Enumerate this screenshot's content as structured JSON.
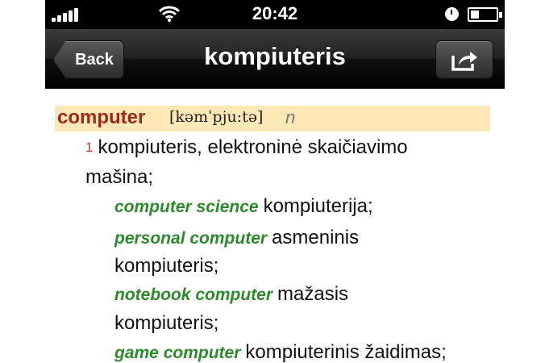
{
  "status_bar": {
    "time": "20:42",
    "icons": [
      "signal-bars-icon",
      "wifi-icon",
      "clock-icon",
      "battery-icon"
    ]
  },
  "nav": {
    "back_label": "Back",
    "title": "kompiuteris",
    "share_icon": "share-icon"
  },
  "entry": {
    "headword": "computer",
    "pronunciation": "[kəmˈpju:tə]",
    "part_of_speech": "n",
    "sense_number": "1",
    "definition_line1": "kompiuteris, elektroninė skaičiavimo",
    "definition_line2": "mašina;",
    "examples": [
      {
        "phrase": "computer science",
        "translation": "kompiuterija;",
        "continuation": ""
      },
      {
        "phrase": "personal computer",
        "translation": "asmeninis",
        "continuation": "kompiuteris;"
      },
      {
        "phrase": "notebook computer",
        "translation": "mažasis",
        "continuation": "kompiuteris;"
      },
      {
        "phrase": "game computer",
        "translation": "kompiuterinis žaidimas;",
        "continuation": ""
      }
    ]
  },
  "colors": {
    "headword": "#9b2a1c",
    "example": "#2c8a2c",
    "highlight": "#fde8b6",
    "sense_number": "#c0392b"
  }
}
